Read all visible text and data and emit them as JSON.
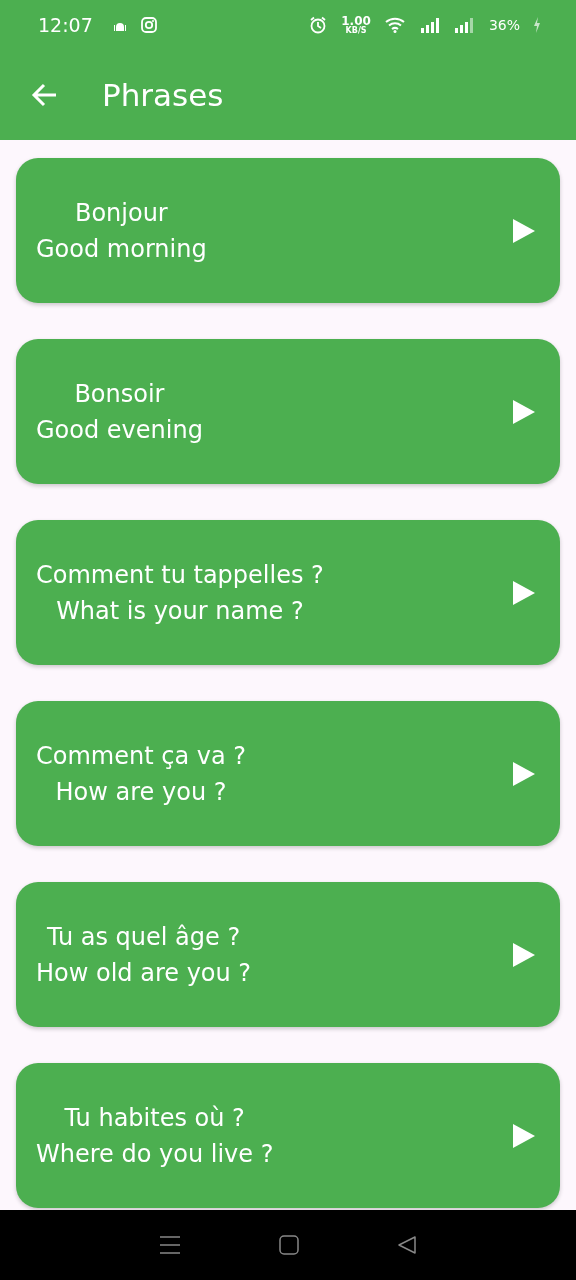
{
  "status_bar": {
    "time": "12:07",
    "speed_value": "1.00",
    "speed_unit": "KB/S",
    "battery": "36%"
  },
  "app_bar": {
    "title": "Phrases"
  },
  "phrases": [
    {
      "french": "Bonjour",
      "english": "Good morning"
    },
    {
      "french": "Bonsoir",
      "english": "Good evening"
    },
    {
      "french": "Comment tu tappelles ?",
      "english": "What is your name ?"
    },
    {
      "french": "Comment ça va ?",
      "english": "How are you ?"
    },
    {
      "french": "Tu as quel âge ?",
      "english": "How old are you ?"
    },
    {
      "french": "Tu habites où ?",
      "english": "Where do you live ?"
    }
  ]
}
